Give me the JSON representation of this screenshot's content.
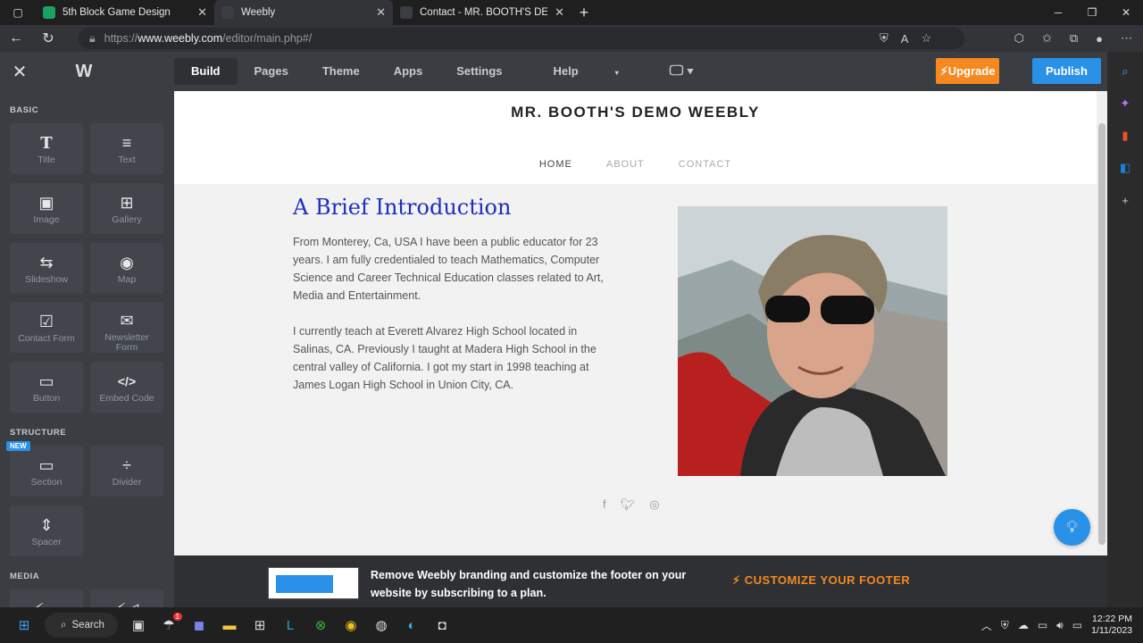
{
  "browser": {
    "tabs": [
      {
        "title": "5th Block Game Design",
        "color": "#1aa260"
      },
      {
        "title": "Weebly",
        "color": "#2a2a35"
      },
      {
        "title": "Contact - MR. BOOTH'S DEMO W",
        "color": "#2a2a35"
      }
    ],
    "url_prefix": "https://",
    "url_domain": "www.weebly.com",
    "url_path": "/editor/main.php#/"
  },
  "editor": {
    "menu": [
      "Build",
      "Pages",
      "Theme",
      "Apps",
      "Settings",
      "Help"
    ],
    "upgrade_label": "Upgrade",
    "publish_label": "Publish",
    "sections": {
      "basic": "BASIC",
      "structure": "STRUCTURE",
      "media": "MEDIA"
    },
    "tiles": [
      {
        "label": "Title",
        "icon": "T"
      },
      {
        "label": "Text",
        "icon": "≡"
      },
      {
        "label": "Image",
        "icon": "▣"
      },
      {
        "label": "Gallery",
        "icon": "⊞"
      },
      {
        "label": "Slideshow",
        "icon": "⇆"
      },
      {
        "label": "Map",
        "icon": "◉"
      },
      {
        "label": "Contact Form",
        "icon": "☑"
      },
      {
        "label": "Newsletter Form",
        "icon": "✉"
      },
      {
        "label": "Button",
        "icon": "▭"
      },
      {
        "label": "Embed Code",
        "icon": "</>"
      },
      {
        "label": "Section",
        "icon": "▭"
      },
      {
        "label": "Divider",
        "icon": "÷"
      },
      {
        "label": "Spacer",
        "icon": "⇕"
      }
    ],
    "new_badge": "NEW"
  },
  "site": {
    "title": "MR. BOOTH'S DEMO WEEBLY",
    "nav": [
      "HOME",
      "ABOUT",
      "CONTACT"
    ],
    "heading": "A Brief Introduction",
    "para1": "From Monterey, Ca, USA I have been a public educator for 23 years. I am fully credentialed to teach Mathematics, Computer Science and Career Technical Education classes related to Art, Media and Entertainment.",
    "para2": "I currently teach at Everett Alvarez High School located in Salinas, CA. Previously I taught at Madera High School in the central valley of California. I got my start in 1998 teaching at James Logan High School in Union City, CA."
  },
  "footer_banner": {
    "text": "Remove Weebly branding and customize the footer on your website by subscribing to a plan.",
    "cta": "CUSTOMIZE YOUR FOOTER"
  },
  "taskbar": {
    "search_label": "Search",
    "time": "12:22 PM",
    "date": "1/11/2023",
    "notification_count": "1"
  }
}
